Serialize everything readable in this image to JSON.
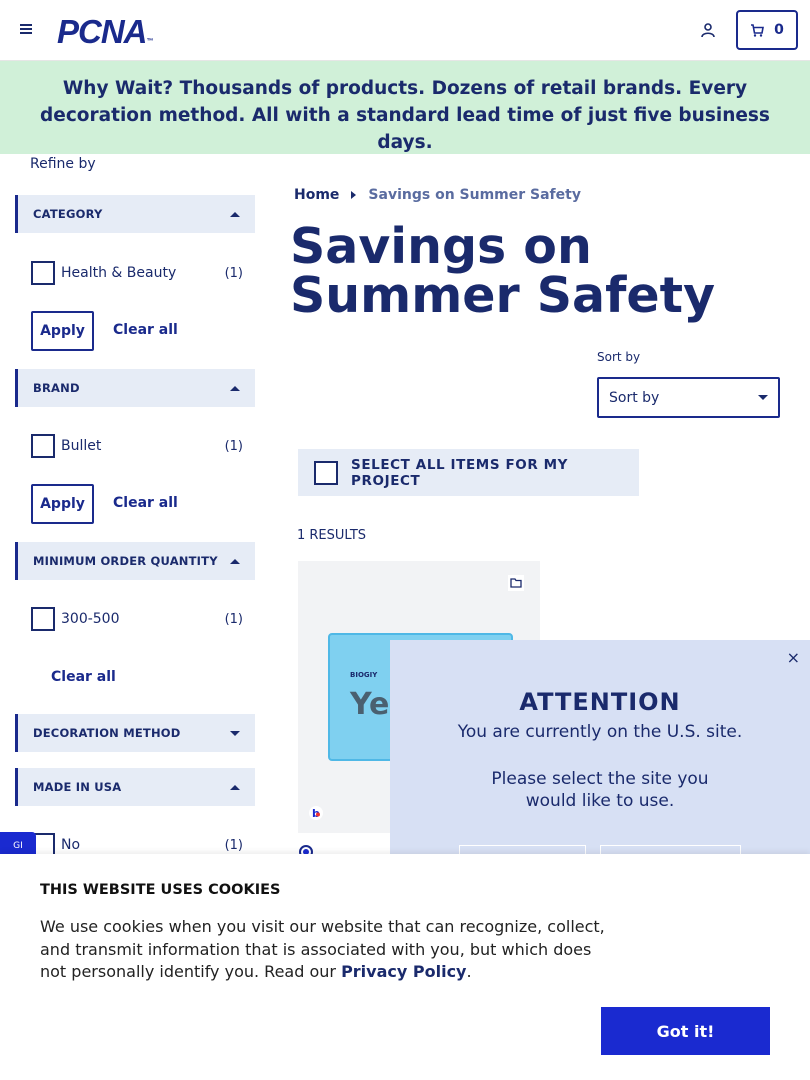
{
  "header": {
    "logo": "PCNA",
    "logo_mark": "™",
    "cart_count": "0"
  },
  "promo": {
    "lead": "Why Wait?",
    "text": "Thousands of products. Dozens of retail brands. Every decoration method. All with a standard lead time of just five business days."
  },
  "sidebar": {
    "refine_label": "Refine by",
    "apply_label": "Apply",
    "clear_label": "Clear all",
    "facets": [
      {
        "title": "CATEGORY",
        "expanded": true,
        "options": [
          {
            "label": "Health & Beauty",
            "count": "(1)"
          }
        ]
      },
      {
        "title": "BRAND",
        "expanded": true,
        "options": [
          {
            "label": "Bullet",
            "count": "(1)"
          }
        ]
      },
      {
        "title": "MINIMUM ORDER QUANTITY",
        "expanded": true,
        "options": [
          {
            "label": "300-500",
            "count": "(1)"
          }
        ]
      },
      {
        "title": "DECORATION METHOD",
        "expanded": false,
        "options": []
      },
      {
        "title": "MADE IN USA",
        "expanded": true,
        "options": [
          {
            "label": "No",
            "count": "(1)"
          }
        ]
      }
    ]
  },
  "breadcrumb": {
    "home": "Home",
    "current": "Savings on Summer Safety"
  },
  "main": {
    "title": "Savings on Summer Safety",
    "sort_label": "Sort by",
    "sort_value": "Sort by",
    "select_all_label": "SELECT ALL ITEMS FOR MY PROJECT",
    "results_count": "1 RESULTS",
    "product": {
      "brand_text": "BIOGIY",
      "image_text": "Ye"
    }
  },
  "side_tab": {
    "label": "GI"
  },
  "attention_modal": {
    "close": "×",
    "title": "ATTENTION",
    "line1": "You are currently on the U.S. site.",
    "line2": "Please select the site you would like to use."
  },
  "cookie_banner": {
    "title": "THIS WEBSITE USES COOKIES",
    "text": "We use cookies when you visit our website that can recognize, collect, and transmit information that is associated with you, but which does not personally identify you. Read our",
    "link": "Privacy Policy",
    "button": "Got it!"
  },
  "colors": {
    "brand_navy": "#1a2a6c",
    "accent_blue": "#1a2ad0",
    "promo_bg": "#d0f0d8",
    "facet_bg": "#e6ecf6",
    "modal_bg": "#d7e0f4"
  }
}
